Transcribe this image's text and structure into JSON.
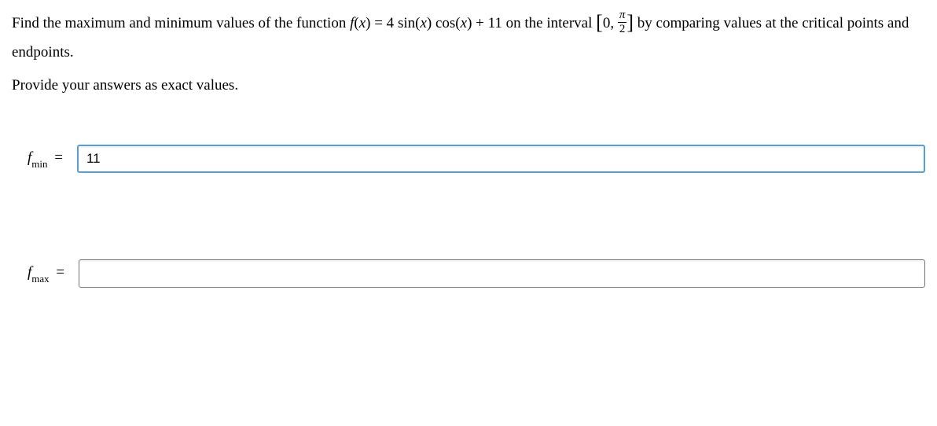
{
  "question": {
    "prefix": "Find the maximum and minimum values of the function ",
    "func_letter": "f",
    "func_arg_open": "(",
    "func_arg": "x",
    "func_arg_close": ") = 4 ",
    "sin": "sin",
    "open1": "(",
    "x1": "x",
    "close1": ") ",
    "cos": "cos",
    "open2": "(",
    "x2": "x",
    "close2": ") + 11 on the interval ",
    "bracket_open": "[",
    "interval_start": "0, ",
    "frac_num": "π",
    "frac_den": "2",
    "bracket_close": "]",
    "suffix": " by comparing values at the critical points and endpoints."
  },
  "instruction": "Provide your answers as exact values.",
  "answers": {
    "fmin": {
      "letter": "f",
      "sub": "min",
      "equals": " = ",
      "value": "11"
    },
    "fmax": {
      "letter": "f",
      "sub": "max",
      "equals": " = ",
      "value": ""
    }
  }
}
